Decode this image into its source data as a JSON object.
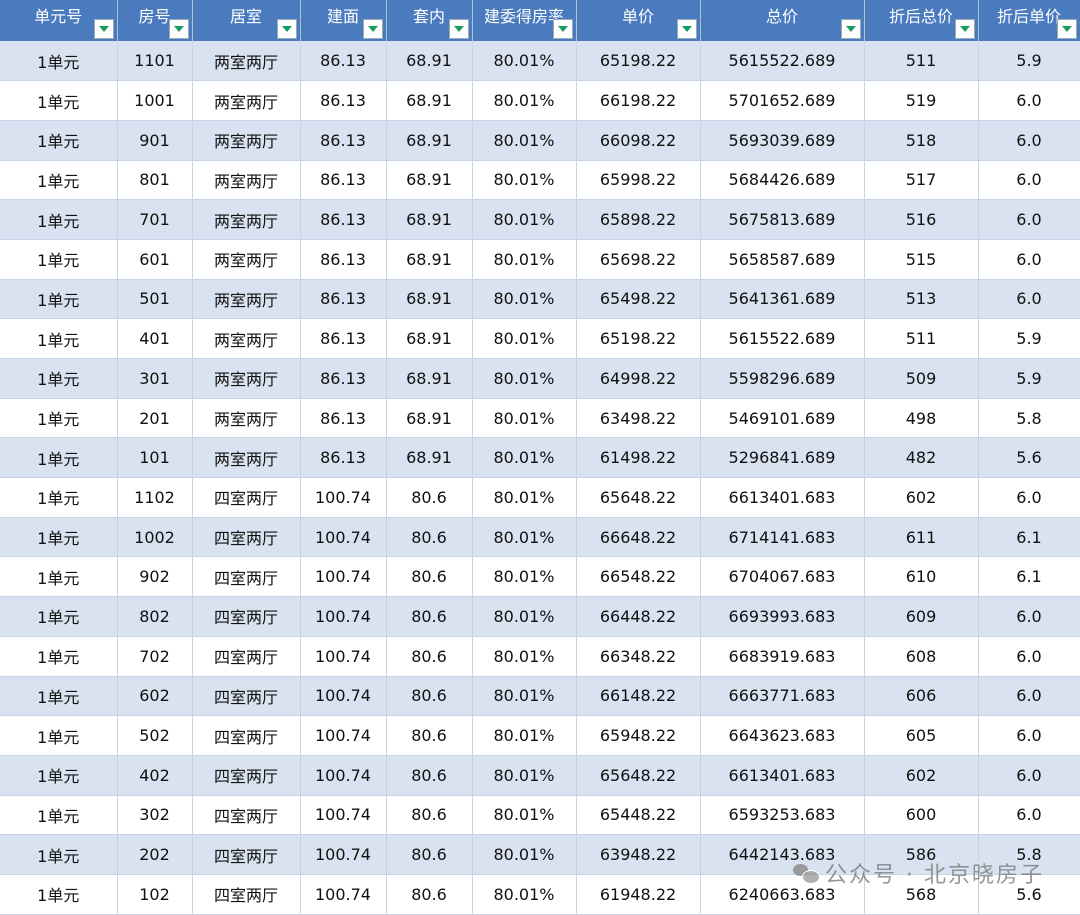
{
  "table": {
    "headers": [
      "单元号",
      "房号",
      "居室",
      "建面",
      "套内",
      "建委得房率",
      "单价",
      "总价",
      "折后总价",
      "折后单价"
    ],
    "rows": [
      [
        "1单元",
        "1101",
        "两室两厅",
        "86.13",
        "68.91",
        "80.01%",
        "65198.22",
        "5615522.689",
        "511",
        "5.9"
      ],
      [
        "1单元",
        "1001",
        "两室两厅",
        "86.13",
        "68.91",
        "80.01%",
        "66198.22",
        "5701652.689",
        "519",
        "6.0"
      ],
      [
        "1单元",
        "901",
        "两室两厅",
        "86.13",
        "68.91",
        "80.01%",
        "66098.22",
        "5693039.689",
        "518",
        "6.0"
      ],
      [
        "1单元",
        "801",
        "两室两厅",
        "86.13",
        "68.91",
        "80.01%",
        "65998.22",
        "5684426.689",
        "517",
        "6.0"
      ],
      [
        "1单元",
        "701",
        "两室两厅",
        "86.13",
        "68.91",
        "80.01%",
        "65898.22",
        "5675813.689",
        "516",
        "6.0"
      ],
      [
        "1单元",
        "601",
        "两室两厅",
        "86.13",
        "68.91",
        "80.01%",
        "65698.22",
        "5658587.689",
        "515",
        "6.0"
      ],
      [
        "1单元",
        "501",
        "两室两厅",
        "86.13",
        "68.91",
        "80.01%",
        "65498.22",
        "5641361.689",
        "513",
        "6.0"
      ],
      [
        "1单元",
        "401",
        "两室两厅",
        "86.13",
        "68.91",
        "80.01%",
        "65198.22",
        "5615522.689",
        "511",
        "5.9"
      ],
      [
        "1单元",
        "301",
        "两室两厅",
        "86.13",
        "68.91",
        "80.01%",
        "64998.22",
        "5598296.689",
        "509",
        "5.9"
      ],
      [
        "1单元",
        "201",
        "两室两厅",
        "86.13",
        "68.91",
        "80.01%",
        "63498.22",
        "5469101.689",
        "498",
        "5.8"
      ],
      [
        "1单元",
        "101",
        "两室两厅",
        "86.13",
        "68.91",
        "80.01%",
        "61498.22",
        "5296841.689",
        "482",
        "5.6"
      ],
      [
        "1单元",
        "1102",
        "四室两厅",
        "100.74",
        "80.6",
        "80.01%",
        "65648.22",
        "6613401.683",
        "602",
        "6.0"
      ],
      [
        "1单元",
        "1002",
        "四室两厅",
        "100.74",
        "80.6",
        "80.01%",
        "66648.22",
        "6714141.683",
        "611",
        "6.1"
      ],
      [
        "1单元",
        "902",
        "四室两厅",
        "100.74",
        "80.6",
        "80.01%",
        "66548.22",
        "6704067.683",
        "610",
        "6.1"
      ],
      [
        "1单元",
        "802",
        "四室两厅",
        "100.74",
        "80.6",
        "80.01%",
        "66448.22",
        "6693993.683",
        "609",
        "6.0"
      ],
      [
        "1单元",
        "702",
        "四室两厅",
        "100.74",
        "80.6",
        "80.01%",
        "66348.22",
        "6683919.683",
        "608",
        "6.0"
      ],
      [
        "1单元",
        "602",
        "四室两厅",
        "100.74",
        "80.6",
        "80.01%",
        "66148.22",
        "6663771.683",
        "606",
        "6.0"
      ],
      [
        "1单元",
        "502",
        "四室两厅",
        "100.74",
        "80.6",
        "80.01%",
        "65948.22",
        "6643623.683",
        "605",
        "6.0"
      ],
      [
        "1单元",
        "402",
        "四室两厅",
        "100.74",
        "80.6",
        "80.01%",
        "65648.22",
        "6613401.683",
        "602",
        "6.0"
      ],
      [
        "1单元",
        "302",
        "四室两厅",
        "100.74",
        "80.6",
        "80.01%",
        "65448.22",
        "6593253.683",
        "600",
        "6.0"
      ],
      [
        "1单元",
        "202",
        "四室两厅",
        "100.74",
        "80.6",
        "80.01%",
        "63948.22",
        "6442143.683",
        "586",
        "5.8"
      ],
      [
        "1单元",
        "102",
        "四室两厅",
        "100.74",
        "80.6",
        "80.01%",
        "61948.22",
        "6240663.683",
        "568",
        "5.6"
      ]
    ]
  },
  "watermark": {
    "icon": "wechat-icon",
    "text": "公众号 · 北京晓房子"
  },
  "colors": {
    "header_bg": "#4a7bbf",
    "header_text": "#ffffff",
    "row_band": "#d9e2f0",
    "row_plain": "#ffffff",
    "filter_arrow": "#1a9e60"
  }
}
